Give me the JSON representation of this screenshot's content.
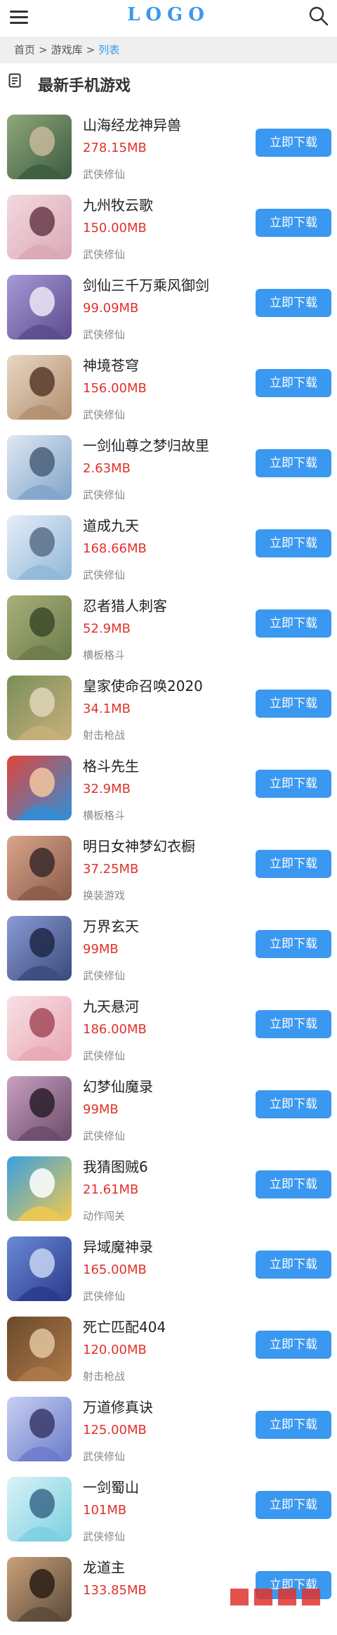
{
  "header": {
    "logo": "LOGO",
    "menu_icon": "hamburger-menu-icon",
    "search_icon": "search-icon",
    "accent": "#3a98f0"
  },
  "breadcrumb": {
    "home": "首页",
    "library": "游戏库",
    "current": "列表",
    "separator": ">"
  },
  "section": {
    "title": "最新手机游戏",
    "icon": "document-list-icon"
  },
  "download_label": "立即下载",
  "colors": {
    "size_text": "#e0322b",
    "button_bg": "#3a98f0",
    "breadcrumb_bg": "#efefef"
  },
  "games": [
    {
      "name": "山海经龙神异兽",
      "size": "278.15MB",
      "category": "武侠修仙"
    },
    {
      "name": "九州牧云歌",
      "size": "150.00MB",
      "category": "武侠修仙"
    },
    {
      "name": "剑仙三千万乘风御剑",
      "size": "99.09MB",
      "category": "武侠修仙"
    },
    {
      "name": "神境苍穹",
      "size": "156.00MB",
      "category": "武侠修仙"
    },
    {
      "name": "一剑仙尊之梦归故里",
      "size": "2.63MB",
      "category": "武侠修仙"
    },
    {
      "name": "道成九天",
      "size": "168.66MB",
      "category": "武侠修仙"
    },
    {
      "name": "忍者猎人刺客",
      "size": "52.9MB",
      "category": "横板格斗"
    },
    {
      "name": "皇家使命召唤2020",
      "size": "34.1MB",
      "category": "射击枪战"
    },
    {
      "name": "格斗先生",
      "size": "32.9MB",
      "category": "横板格斗"
    },
    {
      "name": "明日女神梦幻衣橱",
      "size": "37.25MB",
      "category": "换装游戏"
    },
    {
      "name": "万界玄天",
      "size": "99MB",
      "category": "武侠修仙"
    },
    {
      "name": "九天悬河",
      "size": "186.00MB",
      "category": "武侠修仙"
    },
    {
      "name": "幻梦仙魔录",
      "size": "99MB",
      "category": "武侠修仙"
    },
    {
      "name": "我猜图贼6",
      "size": "21.61MB",
      "category": "动作闯关"
    },
    {
      "name": "异域魔神录",
      "size": "165.00MB",
      "category": "武侠修仙"
    },
    {
      "name": "死亡匹配404",
      "size": "120.00MB",
      "category": "射击枪战"
    },
    {
      "name": "万道修真诀",
      "size": "125.00MB",
      "category": "武侠修仙"
    },
    {
      "name": "一剑蜀山",
      "size": "101MB",
      "category": "武侠修仙"
    },
    {
      "name": "龙道主",
      "size": "133.85MB",
      "category": ""
    }
  ]
}
